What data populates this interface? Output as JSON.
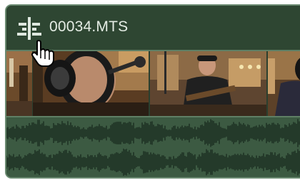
{
  "clip": {
    "name": "00034.MTS",
    "icons": {
      "split": "split-clip-icon",
      "cursor": "hand-pointer-icon"
    },
    "colors": {
      "header_bg": "#2e4632",
      "border": "#6b8a71",
      "waveform_bg": "#3c5a42",
      "waveform_fg": "#1f3224"
    }
  }
}
